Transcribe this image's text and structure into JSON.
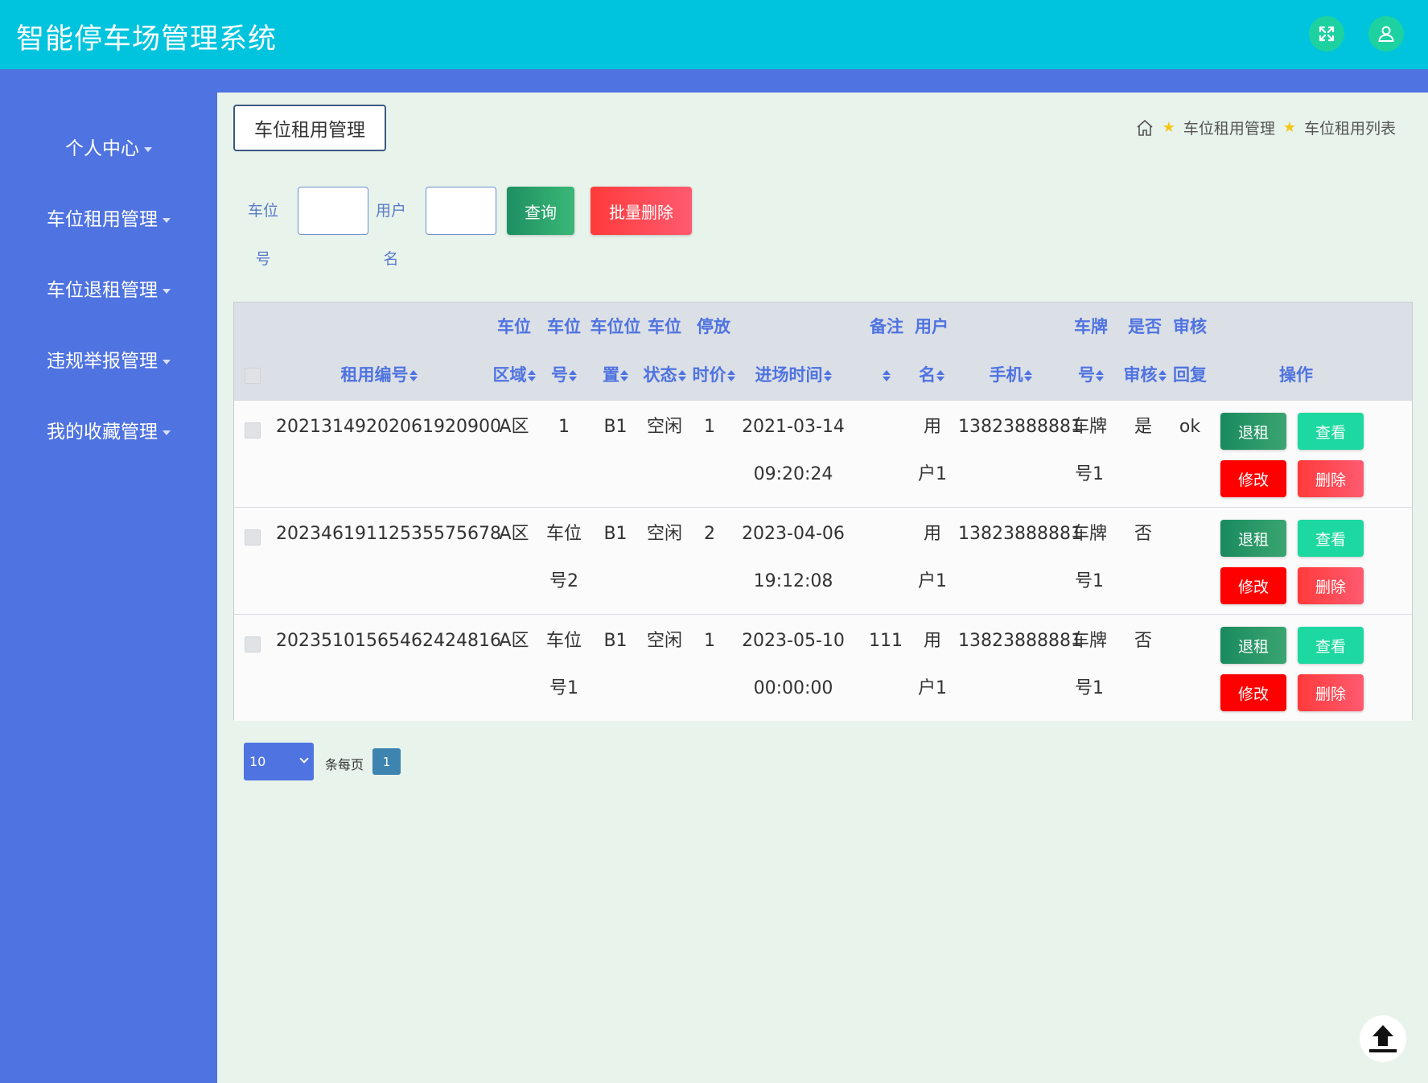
{
  "header": {
    "title": "智能停车场管理系统"
  },
  "sidebar": {
    "items": [
      {
        "label": "个人中心"
      },
      {
        "label": "车位租用管理"
      },
      {
        "label": "车位退租管理"
      },
      {
        "label": "违规举报管理"
      },
      {
        "label": "我的收藏管理"
      }
    ]
  },
  "page": {
    "tag": "车位租用管理",
    "breadcrumb": [
      "车位租用管理",
      "车位租用列表"
    ]
  },
  "search": {
    "field1_label_line1": "车位",
    "field1_label_line2": "号",
    "field2_label_line1": "用户",
    "field2_label_line2": "名",
    "query_label": "查询",
    "batch_delete_label": "批量删除"
  },
  "table": {
    "headers": {
      "rent_no": "租用编号",
      "area": [
        "车位",
        "区域"
      ],
      "spot_no": [
        "车位",
        "号"
      ],
      "position": [
        "车位位",
        "置"
      ],
      "status": [
        "车位",
        "状态"
      ],
      "hourly_price": [
        "停放",
        "时价"
      ],
      "entry_time": "进场时间",
      "remark": "备注",
      "username": [
        "用户",
        "名"
      ],
      "phone": "手机",
      "plate": [
        "车牌",
        "号"
      ],
      "audited": [
        "是否",
        "审核"
      ],
      "audit_reply": [
        "审核",
        "回复"
      ],
      "actions": "操作"
    },
    "rows": [
      {
        "rent_no": "20213149202061920900",
        "area": "A区",
        "spot_no": [
          "1",
          ""
        ],
        "position": "B1",
        "status": "空闲",
        "hourly_price": "1",
        "entry_time": [
          "2021-03-14",
          "09:20:24"
        ],
        "remark": "",
        "username": [
          "用",
          "户1"
        ],
        "phone": "13823888881",
        "plate": [
          "车牌",
          "号1"
        ],
        "audited": "是",
        "audit_reply": "ok"
      },
      {
        "rent_no": "20234619112535575678",
        "area": "A区",
        "spot_no": [
          "车位",
          "号2"
        ],
        "position": "B1",
        "status": "空闲",
        "hourly_price": "2",
        "entry_time": [
          "2023-04-06",
          "19:12:08"
        ],
        "remark": "",
        "username": [
          "用",
          "户1"
        ],
        "phone": "13823888881",
        "plate": [
          "车牌",
          "号1"
        ],
        "audited": "否",
        "audit_reply": ""
      },
      {
        "rent_no": "20235101565462424816",
        "area": "A区",
        "spot_no": [
          "车位",
          "号1"
        ],
        "position": "B1",
        "status": "空闲",
        "hourly_price": "1",
        "entry_time": [
          "2023-05-10",
          "00:00:00"
        ],
        "remark": "111",
        "username": [
          "用",
          "户1"
        ],
        "phone": "13823888881",
        "plate": [
          "车牌",
          "号1"
        ],
        "audited": "否",
        "audit_reply": ""
      }
    ],
    "row_actions": {
      "tuizu": "退租",
      "view": "查看",
      "edit": "修改",
      "delete": "删除"
    }
  },
  "pagination": {
    "page_size": "10",
    "per_page_label": "条每页",
    "current_page": "1"
  },
  "colors": {
    "topbar": "#00c4de",
    "sidebar": "#4f73e0",
    "background": "#e8f3ec",
    "accent": "#4f73e0"
  },
  "icons": [
    "fullscreen-icon",
    "user-icon",
    "home-icon",
    "star-icon",
    "back-to-top-icon"
  ]
}
